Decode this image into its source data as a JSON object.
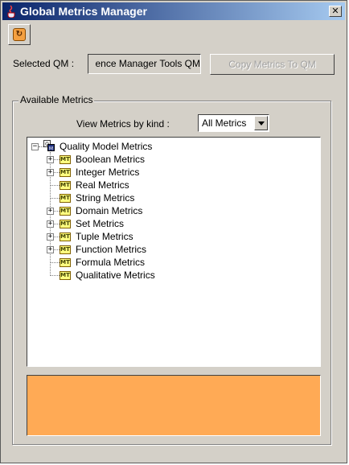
{
  "window": {
    "title": "Global Metrics Manager",
    "close_glyph": "✕"
  },
  "toolbar": {
    "refresh_icon": "refresh-icon"
  },
  "qm": {
    "label": "Selected QM :",
    "value": "ence Manager Tools QM"
  },
  "copy_button": {
    "label": "Copy Metrics To QM"
  },
  "available": {
    "group_title": "Available Metrics",
    "kind_label": "View Metrics by kind :",
    "kind_selected": "All Metrics"
  },
  "tree": {
    "root": "Quality Model Metrics",
    "items": [
      {
        "label": "Boolean Metrics",
        "expandable": true
      },
      {
        "label": "Integer Metrics",
        "expandable": true
      },
      {
        "label": "Real Metrics",
        "expandable": false
      },
      {
        "label": "String Metrics",
        "expandable": false
      },
      {
        "label": "Domain Metrics",
        "expandable": true
      },
      {
        "label": "Set Metrics",
        "expandable": true
      },
      {
        "label": "Tuple Metrics",
        "expandable": true
      },
      {
        "label": "Function Metrics",
        "expandable": true
      },
      {
        "label": "Formula Metrics",
        "expandable": false
      },
      {
        "label": "Qualitative Metrics",
        "expandable": false
      }
    ]
  },
  "colors": {
    "info_panel": "#ffaa55",
    "titlebar_start": "#0a246a",
    "titlebar_end": "#a6caf0"
  }
}
